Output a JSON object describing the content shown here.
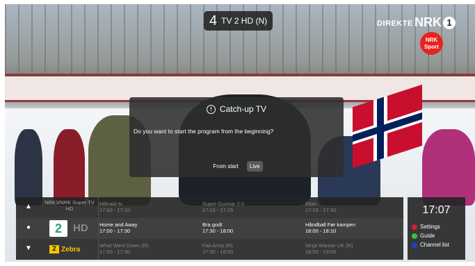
{
  "channel_badge": {
    "number": "4",
    "name": "TV 2 HD (N)"
  },
  "broadcast": {
    "direkte": "DIREKTE",
    "brand": "NRK",
    "brand_number": "1",
    "sport_line1": "NRK",
    "sport_line2": "Sport"
  },
  "dialog": {
    "title": "Catch-up TV",
    "question": "Do you want to start the program from the beginning?",
    "from_start": "From start",
    "live": "Live"
  },
  "guide": {
    "rows": [
      {
        "control": "▲",
        "channel": "NRK3/NRK Super TV HD",
        "programs": [
          {
            "title": "Månaid-tv",
            "time": "17:00 - 17:10"
          },
          {
            "title": "Super-Gunnar 2.0",
            "time": "17:10 - 17:15"
          },
          {
            "title": "Elias",
            "time": "17:15 - 17:30"
          }
        ]
      },
      {
        "control": "●",
        "channel_logo": "2",
        "channel_hd": "HD",
        "programs": [
          {
            "title": "Home and Away",
            "time": "17:00 - 17:30"
          },
          {
            "title": "Bra godt",
            "time": "17:30 - 18:00"
          },
          {
            "title": "Håndball Før kampen",
            "time": "18:00 - 18:10"
          }
        ]
      },
      {
        "control": "▼",
        "channel_logo": "2",
        "channel_name": "Zebra",
        "programs": [
          {
            "title": "What Went Down (R)",
            "time": "17:00 - 17:30"
          },
          {
            "title": "Fail Army (R)",
            "time": "17:30 - 18:00"
          },
          {
            "title": "Ninja Warrior UK (R)",
            "time": "18:00 - 19:00"
          }
        ]
      }
    ]
  },
  "side_panel": {
    "clock": "17:07",
    "options": [
      {
        "label": "Settings",
        "color": "#d0202a"
      },
      {
        "label": "Guide",
        "color": "#3cbf3c"
      },
      {
        "label": "Channel list",
        "color": "#2040c8"
      }
    ]
  }
}
